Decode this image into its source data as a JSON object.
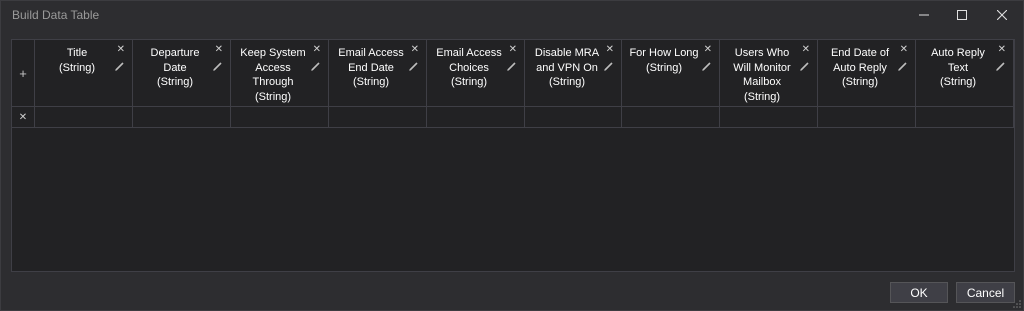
{
  "window": {
    "title": "Build Data Table"
  },
  "controls": {
    "minimize": "minimize-icon",
    "maximize": "maximize-icon",
    "close": "close-icon"
  },
  "table": {
    "add_column_glyph": "+",
    "remove_glyph": "✕",
    "columns": [
      {
        "label": "Title\n(String)"
      },
      {
        "label": "Departure\nDate\n(String)"
      },
      {
        "label": "Keep System\nAccess\nThrough\n(String)"
      },
      {
        "label": "Email Access\nEnd Date\n(String)"
      },
      {
        "label": "Email Access\nChoices\n(String)"
      },
      {
        "label": "Disable MRA\nand VPN On\n(String)"
      },
      {
        "label": "For How Long\n(String)"
      },
      {
        "label": "Users Who\nWill Monitor\nMailbox\n(String)"
      },
      {
        "label": "End Date of\nAuto Reply\n(String)"
      },
      {
        "label": "Auto Reply\nText\n(String)"
      }
    ],
    "rows": [
      [
        "",
        "",
        "",
        "",
        "",
        "",
        "",
        "",
        "",
        ""
      ]
    ]
  },
  "buttons": {
    "ok": "OK",
    "cancel": "Cancel"
  },
  "colors": {
    "background": "#2d2d30",
    "grid_background": "#222224",
    "grid_line": "#3f3f46",
    "button": "#3f3f46"
  }
}
